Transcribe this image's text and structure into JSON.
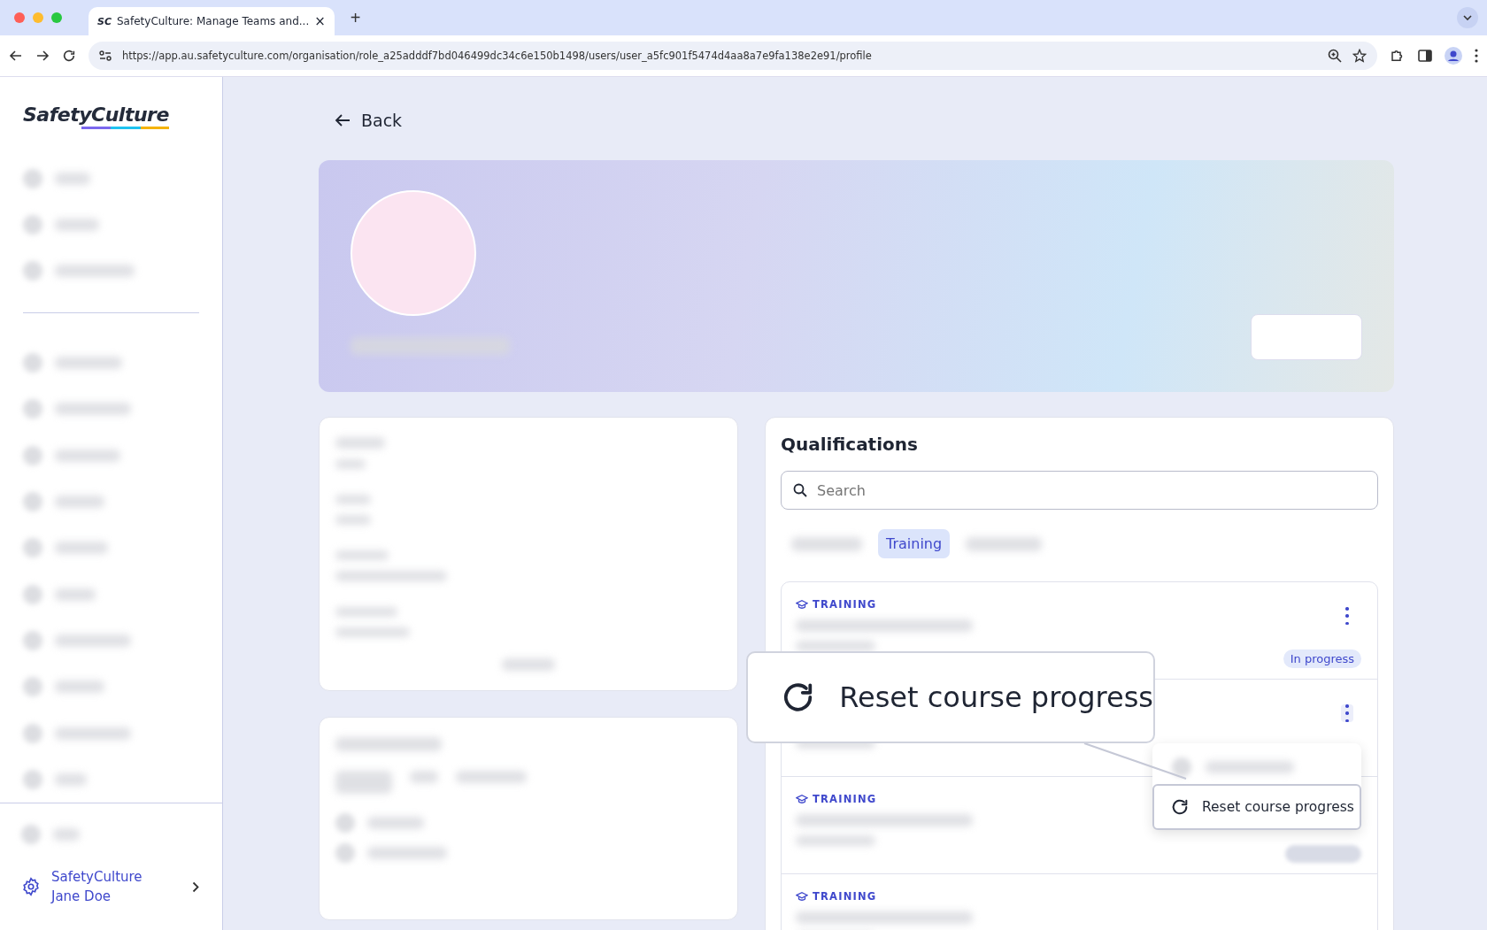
{
  "browser": {
    "tab_icon": "SC",
    "tab_title": "SafetyCulture: Manage Teams and...",
    "tab_close": "×",
    "new_tab": "+",
    "url": "https://app.au.safetyculture.com/organisation/role_a25adddf7bd046499dc34c6e150b1498/users/user_a5fc901f5474d4aa8a7e9fa138e2e91/profile"
  },
  "sidebar": {
    "logo": "SafetyCulture",
    "org": "SafetyCulture",
    "user": "Jane Doe"
  },
  "back": "Back",
  "qualifications": {
    "title": "Qualifications",
    "search": {
      "placeholder": "Search"
    },
    "tabs": [
      {
        "label": "Training",
        "selected": true
      }
    ],
    "items": [
      {
        "category": "TRAINING",
        "status": "In progress",
        "menu_button": true,
        "menu_open": false
      },
      {
        "menu_button": true,
        "menu_open": true
      },
      {
        "category": "TRAINING",
        "menu_button": false,
        "menu_open": false
      },
      {
        "category": "TRAINING",
        "menu_button": false,
        "menu_open": false
      }
    ],
    "menu": {
      "items": [
        {
          "label": "Reset course progress",
          "highlighted": true
        }
      ]
    }
  },
  "callout": {
    "label": "Reset course progress"
  }
}
